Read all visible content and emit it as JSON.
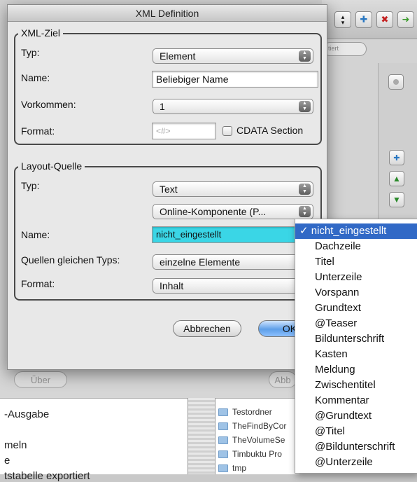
{
  "dialog": {
    "title": "XML Definition"
  },
  "xml_ziel": {
    "group_label": "XML-Ziel",
    "typ_label": "Typ:",
    "typ_value": "Element",
    "name_label": "Name:",
    "name_value": "Beliebiger Name",
    "vorkommen_label": "Vorkommen:",
    "vorkommen_value": "1",
    "format_label": "Format:",
    "format_placeholder": "<#>",
    "cdata_label": "CDATA Section"
  },
  "layout_quelle": {
    "group_label": "Layout-Quelle",
    "typ_label": "Typ:",
    "typ_value": "Text",
    "komponente_value": "Online-Komponente (P...",
    "name_label": "Name:",
    "name_value": "nicht_eingestellt",
    "quellen_label": "Quellen gleichen Typs:",
    "quellen_value": "einzelne Elemente",
    "format_label": "Format:",
    "format_value": "Inhalt"
  },
  "buttons": {
    "cancel": "Abbrechen",
    "ok": "OK"
  },
  "dropdown": {
    "checkmark": "✓",
    "items": [
      "nicht_eingestellt",
      "Dachzeile",
      "Titel",
      "Unterzeile",
      "Vorspann",
      "Grundtext",
      "@Teaser",
      "Bildunterschrift",
      "Kasten",
      "Meldung",
      "Zwischentitel",
      "Kommentar",
      "@Grundtext",
      "@Titel",
      "@Bildunterschrift",
      "@Unterzeile"
    ]
  },
  "background": {
    "field_fragment": "tiert",
    "about_button": "Über",
    "abb_button": "Abb",
    "left_list": [
      "-Ausgabe",
      "meln",
      "e",
      "tstabelle exportiert"
    ],
    "files": [
      "Testordner",
      "TheFindByCor",
      "TheVolumeSe",
      "Timbuktu Pro",
      "tmp"
    ]
  }
}
